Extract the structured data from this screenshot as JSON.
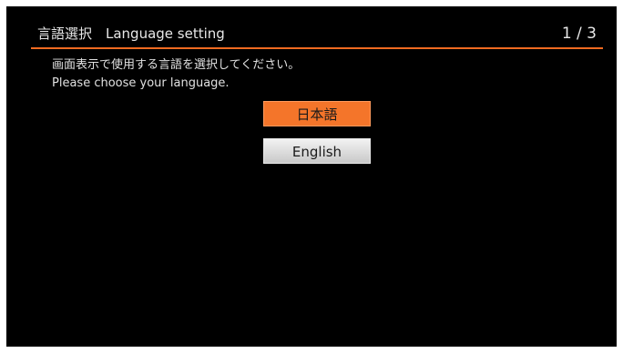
{
  "header": {
    "title": "言語選択　Language setting",
    "page_indicator": "1 / 3"
  },
  "instructions": {
    "line_ja": "画面表示で使用する言語を選択してください。",
    "line_en": "Please choose your language."
  },
  "languages": [
    {
      "label": "日本語",
      "selected": true
    },
    {
      "label": "English",
      "selected": false
    }
  ],
  "colors": {
    "accent": "#f26b21",
    "background": "#000000",
    "selected_button": "#f4752a",
    "normal_button": "#d9d9d9"
  }
}
